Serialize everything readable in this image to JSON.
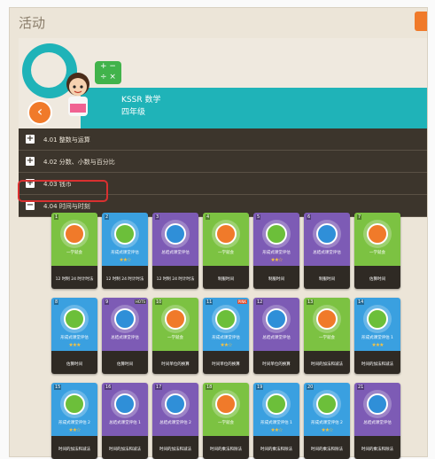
{
  "page": {
    "title": "活动"
  },
  "hero": {
    "subject": "KSSR 数学",
    "grade": "四年级"
  },
  "menu": [
    {
      "label": "4.01 整数与运算",
      "expanded": false
    },
    {
      "label": "4.02 分数、小数与百分比",
      "expanded": false
    },
    {
      "label": "4.03 钱币",
      "expanded": false
    },
    {
      "label": "4.04 时间与时刻",
      "expanded": true
    }
  ],
  "colors": {
    "accent": "#1fb3b8",
    "orange": "#f07a2a",
    "dark": "#3c352c",
    "highlight": "#d93030"
  },
  "cards": [
    {
      "num": "1",
      "theme": "green",
      "icon": "orange",
      "title": "一学就会",
      "stars": "",
      "name": "12 时制 24 时计时法"
    },
    {
      "num": "2",
      "theme": "blue",
      "icon": "green",
      "title": "形成式课堂评估",
      "stars": "★★☆",
      "name": "12 时制 24 时计时法"
    },
    {
      "num": "3",
      "theme": "purple",
      "icon": "blue",
      "title": "总结式课堂评估",
      "stars": "",
      "name": "12 时制 24 时计时法"
    },
    {
      "num": "4",
      "theme": "green",
      "icon": "orange",
      "title": "一学就会",
      "stars": "",
      "name": "制服时间"
    },
    {
      "num": "5",
      "theme": "purple",
      "icon": "green",
      "title": "形成式课堂评估",
      "stars": "★★☆",
      "name": "制服时间"
    },
    {
      "num": "6",
      "theme": "purple",
      "icon": "blue",
      "title": "总结式课堂评估",
      "stars": "",
      "name": "制服时间"
    },
    {
      "num": "7",
      "theme": "green",
      "icon": "orange",
      "title": "一学就会",
      "stars": "",
      "name": "估算时间"
    },
    {
      "num": "8",
      "theme": "blue",
      "icon": "green",
      "title": "形成式课堂评估",
      "stars": "★★★",
      "name": "估算时间"
    },
    {
      "num": "9",
      "theme": "purple",
      "icon": "blue",
      "title": "总结式课堂评估",
      "stars": "",
      "name": "估算时间",
      "tag": "HOTS"
    },
    {
      "num": "10",
      "theme": "green",
      "icon": "orange",
      "title": "一学就会",
      "stars": "",
      "name": "时间单位的换算"
    },
    {
      "num": "11",
      "theme": "blue",
      "icon": "green",
      "title": "形成式课堂评估",
      "stars": "★★☆",
      "name": "时间单位的换算",
      "tag": "PINK"
    },
    {
      "num": "12",
      "theme": "purple",
      "icon": "blue",
      "title": "总结式课堂评估",
      "stars": "",
      "name": "时间单位的换算"
    },
    {
      "num": "13",
      "theme": "green",
      "icon": "orange",
      "title": "一学就会",
      "stars": "",
      "name": "时间的加法和减法"
    },
    {
      "num": "14",
      "theme": "blue",
      "icon": "green",
      "title": "形成式课堂评估 1",
      "stars": "★★★",
      "name": "时间的加法和减法"
    },
    {
      "num": "15",
      "theme": "blue",
      "icon": "green",
      "title": "形成式课堂评估 2",
      "stars": "★★☆",
      "name": "时间的加法和减法"
    },
    {
      "num": "16",
      "theme": "purple",
      "icon": "blue",
      "title": "总结式课堂评估 1",
      "stars": "",
      "name": "时间的加法和减法"
    },
    {
      "num": "17",
      "theme": "purple",
      "icon": "blue",
      "title": "总结式课堂评估 2",
      "stars": "",
      "name": "时间的加法和减法"
    },
    {
      "num": "18",
      "theme": "green",
      "icon": "orange",
      "title": "一学就会",
      "stars": "",
      "name": "时间的乘法和除法"
    },
    {
      "num": "19",
      "theme": "blue",
      "icon": "green",
      "title": "形成式课堂评估 1",
      "stars": "★★☆",
      "name": "时间的乘法和除法"
    },
    {
      "num": "20",
      "theme": "blue",
      "icon": "green",
      "title": "形成式课堂评估 2",
      "stars": "★★☆",
      "name": "时间的乘法和除法"
    },
    {
      "num": "21",
      "theme": "purple",
      "icon": "blue",
      "title": "总结式课堂评估",
      "stars": "",
      "name": "时间的乘法和除法"
    }
  ]
}
